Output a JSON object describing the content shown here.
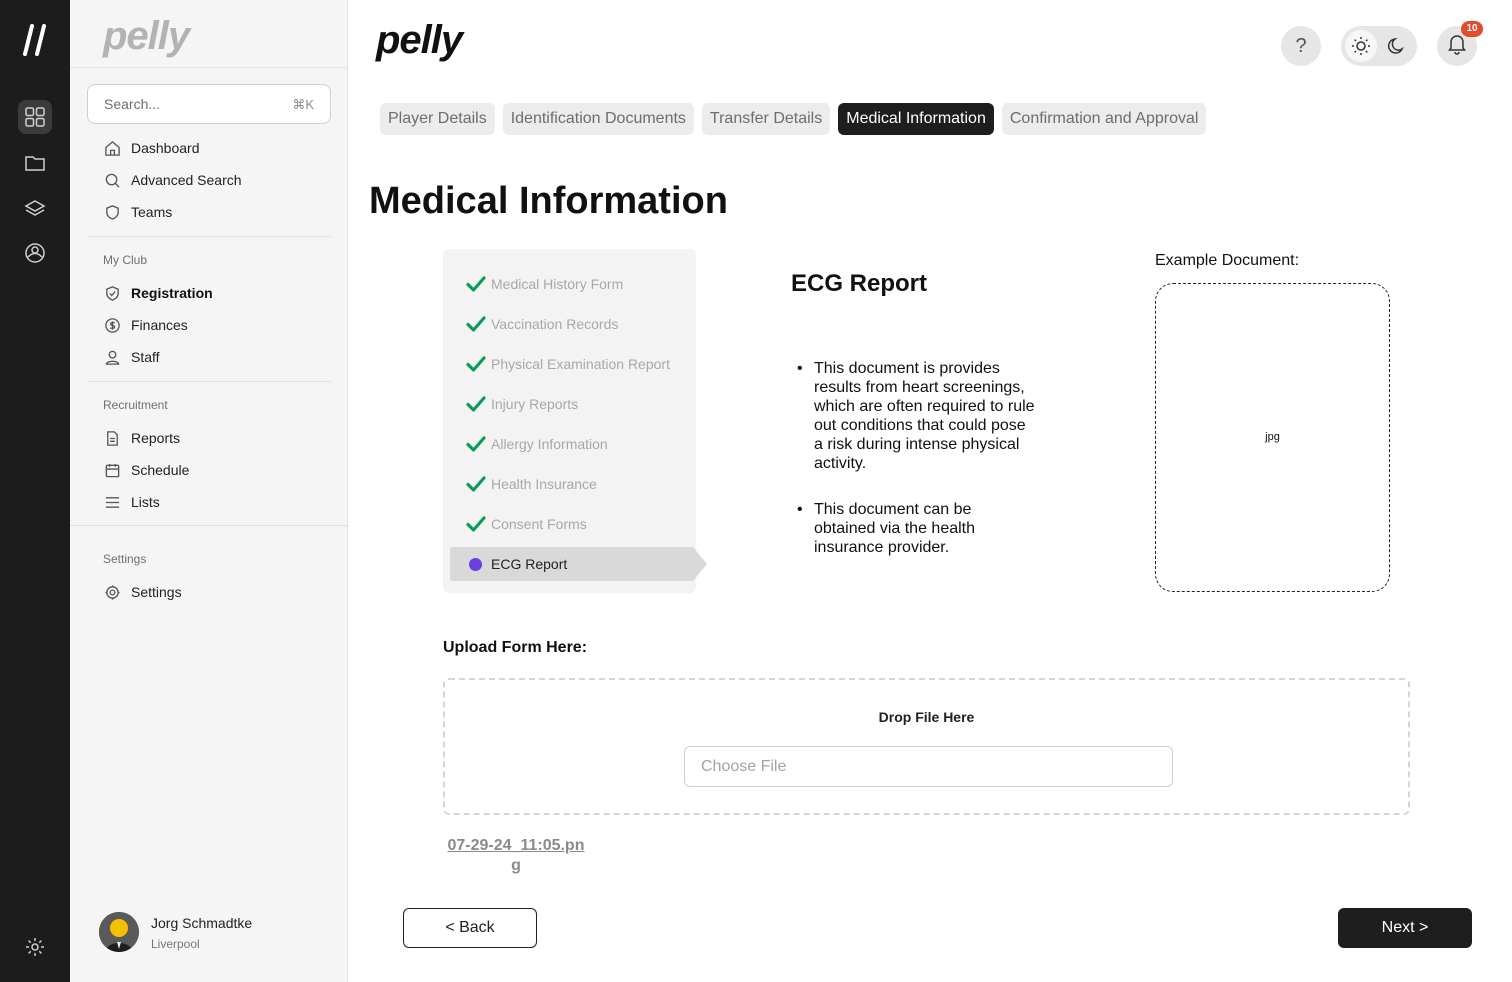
{
  "sidebar": {
    "logo": "pelly",
    "search": {
      "placeholder": "Search...",
      "shortcut": "⌘K"
    },
    "nav": [
      {
        "label": "Dashboard",
        "icon": "home-icon"
      },
      {
        "label": "Advanced Search",
        "icon": "search-icon"
      },
      {
        "label": "Teams",
        "icon": "shield-icon"
      }
    ],
    "my_club": {
      "title": "My Club",
      "items": [
        {
          "label": "Registration",
          "icon": "shield-check-icon",
          "active": true
        },
        {
          "label": "Finances",
          "icon": "dollar-circle-icon"
        },
        {
          "label": "Staff",
          "icon": "user-icon"
        }
      ]
    },
    "recruitment": {
      "title": "Recruitment",
      "items": [
        {
          "label": "Reports",
          "icon": "document-icon"
        },
        {
          "label": "Schedule",
          "icon": "calendar-icon"
        },
        {
          "label": "Lists",
          "icon": "list-icon"
        }
      ]
    },
    "settings": {
      "title": "Settings",
      "items": [
        {
          "label": "Settings",
          "icon": "gear-icon"
        }
      ]
    },
    "user": {
      "name": "Jorg Schmadtke",
      "club": "Liverpool"
    }
  },
  "header": {
    "brand": "pelly",
    "help": "?",
    "notifications_count": "10"
  },
  "tabs": [
    {
      "label": "Player Details",
      "active": false
    },
    {
      "label": "Identification Documents",
      "active": false
    },
    {
      "label": "Transfer Details",
      "active": false
    },
    {
      "label": "Medical Information",
      "active": true
    },
    {
      "label": "Confirmation and Approval",
      "active": false
    }
  ],
  "page": {
    "title": "Medical Information",
    "steps": [
      {
        "label": "Medical History Form",
        "done": true
      },
      {
        "label": "Vaccination Records",
        "done": true
      },
      {
        "label": "Physical Examination Report",
        "done": true
      },
      {
        "label": "Injury Reports",
        "done": true
      },
      {
        "label": "Allergy Information",
        "done": true
      },
      {
        "label": "Health Insurance",
        "done": true
      },
      {
        "label": "Consent Forms",
        "done": true
      }
    ],
    "current_step": "ECG Report",
    "document": {
      "title": "ECG Report",
      "bullets": [
        "This document is provides results from heart screenings, which are often required to rule out conditions that could pose a risk during intense physical activity.",
        "This document can be obtained via the health insurance provider."
      ]
    },
    "example": {
      "label": "Example Document:",
      "file_type": "jpg"
    },
    "upload": {
      "label": "Upload Form Here:",
      "drop_text": "Drop File Here",
      "choose_placeholder": "Choose File",
      "uploaded_file": "07-29-24_11:05.png"
    },
    "back_label": "< Back",
    "next_label": "Next >"
  },
  "colors": {
    "accent": "#1e1e1e",
    "check": "#0a9d55",
    "active_dot": "#6a3fe0",
    "badge": "#e24b2c"
  }
}
